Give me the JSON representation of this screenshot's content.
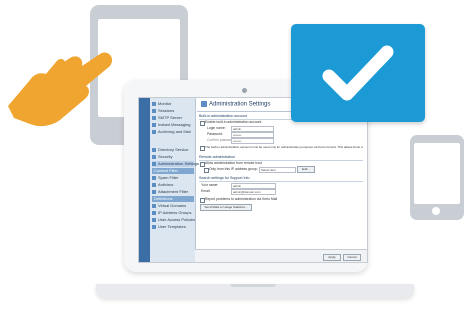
{
  "settings_window": {
    "title": "Administration Settings",
    "sidebar": {
      "items": [
        {
          "label": "Monitor",
          "icon": "monitor-icon"
        },
        {
          "label": "Sessions",
          "icon": "sessions-icon"
        },
        {
          "label": "SMTP Server",
          "icon": "smtp-icon"
        },
        {
          "label": "Instant Messaging",
          "icon": "im-icon"
        },
        {
          "label": "Archiving and Mail",
          "icon": "archive-icon"
        },
        {
          "label": "Directory Service",
          "icon": "directory-icon"
        },
        {
          "label": "Security",
          "icon": "security-icon"
        },
        {
          "label": "Administration Settings",
          "icon": "admin-icon"
        },
        {
          "label": "Spam Filter",
          "icon": "spam-icon"
        },
        {
          "label": "Antivirus",
          "icon": "antivirus-icon"
        },
        {
          "label": "Attachment Filter",
          "icon": "attachment-icon"
        },
        {
          "label": "Virtual Domains",
          "icon": "domains-icon"
        },
        {
          "label": "IP Address Groups",
          "icon": "ip-groups-icon"
        },
        {
          "label": "User Access Policies",
          "icon": "policies-icon"
        },
        {
          "label": "User Templates",
          "icon": "templates-icon"
        }
      ],
      "headers": [
        "Content Filter",
        "Definitions"
      ]
    },
    "sections": {
      "built_in": "Built-in administration account",
      "enable_builtin": "Enable built-in administration account",
      "login_label": "Login name:",
      "login_value": "admin",
      "password_label": "Password:",
      "password_value": "••••••••",
      "confirm_label": "Confirm password:",
      "confirm_value": "••••••••",
      "notice": "The built-in administration account must be used only for administration purposes via Kerio Control. This allows Kerio to log in.",
      "remote": "Remote administration",
      "allow_remote": "Allow administration from remote host",
      "only_ip_label": "Only from this IP address group:",
      "only_ip_value": "Select item",
      "edit_btn": "Edit...",
      "search_section": "Search settings for Support Info",
      "your_name_label": "Your name:",
      "your_name_value": "admin",
      "email_label": "Email:",
      "email_value": "admin@domain.com",
      "report_chk": "Report problems to administration via Kerio Mail",
      "setup_btn": "Send Mails to Usage Statistics..."
    },
    "bottom": {
      "apply": "Apply",
      "cancel": "Cancel"
    }
  },
  "colors": {
    "badge": "#1b9ad6",
    "hand": "#f0a531",
    "device_frame": "#c9ced4",
    "sidebar_accent": "#3a6ea5"
  }
}
